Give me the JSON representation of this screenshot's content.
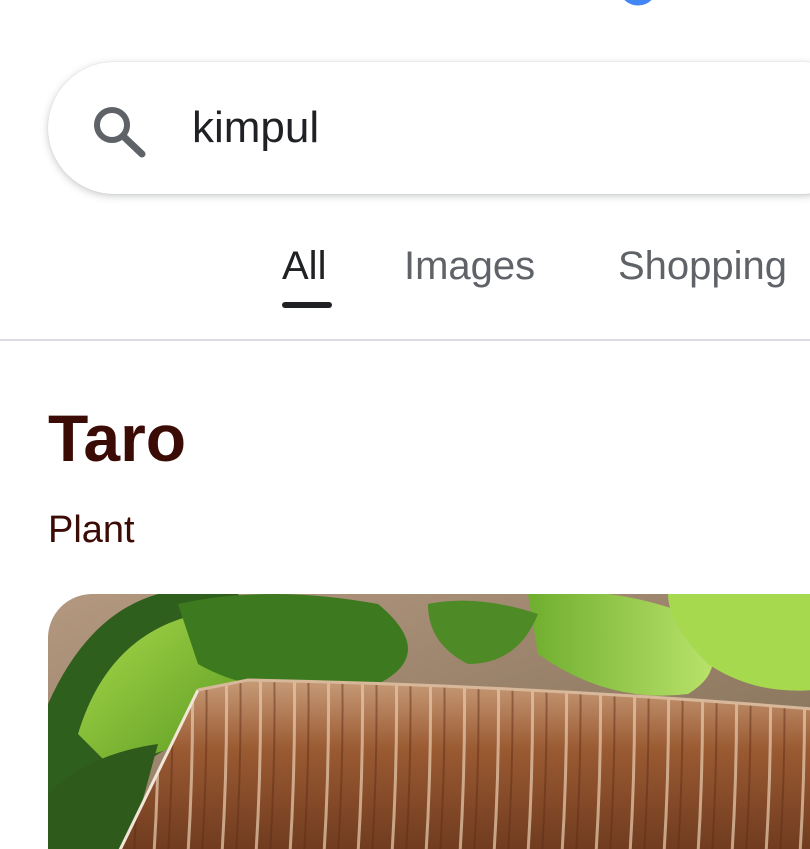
{
  "search": {
    "query": "kimpul"
  },
  "tabs": [
    {
      "label": "All",
      "active": true
    },
    {
      "label": "Images",
      "active": false
    },
    {
      "label": "Shopping",
      "active": false
    }
  ],
  "knowledge_panel": {
    "title": "Taro",
    "subtitle": "Plant",
    "image_icon": "taro-root-photo"
  },
  "colors": {
    "title_text": "#3b0c06",
    "tab_active": "#202124",
    "tab_inactive": "#5f6368",
    "logo_blue": "#4285f4"
  }
}
